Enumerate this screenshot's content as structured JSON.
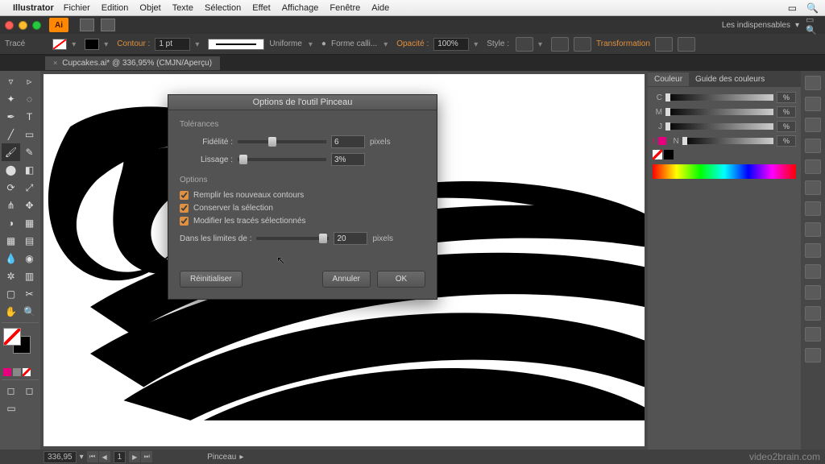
{
  "menubar": {
    "app": "Illustrator",
    "items": [
      "Fichier",
      "Edition",
      "Objet",
      "Texte",
      "Sélection",
      "Effet",
      "Affichage",
      "Fenêtre",
      "Aide"
    ]
  },
  "titlebar": {
    "ai_badge": "Ai",
    "workspace": "Les indispensables"
  },
  "controlbar": {
    "left_label": "Tracé",
    "stroke_label": "Contour :",
    "stroke_val": "1 pt",
    "uniform": "Uniforme",
    "brush_style": "Forme calli...",
    "opacity_label": "Opacité :",
    "opacity_val": "100%",
    "style_label": "Style :",
    "transform": "Transformation"
  },
  "doc_tab": {
    "title": "Cupcakes.ai* @ 336,95% (CMJN/Aperçu)"
  },
  "dialog": {
    "title": "Options de l'outil Pinceau",
    "tolerances_label": "Tolérances",
    "fidelity_label": "Fidélité :",
    "fidelity_val": "6",
    "fidelity_unit": "pixels",
    "smoothing_label": "Lissage :",
    "smoothing_val": "3%",
    "options_label": "Options",
    "fill_new": "Remplir les nouveaux contours",
    "keep_sel": "Conserver la sélection",
    "edit_sel": "Modifier les tracés sélectionnés",
    "within_label": "Dans les limites de :",
    "within_val": "20",
    "within_unit": "pixels",
    "reset": "Réinitialiser",
    "cancel": "Annuler",
    "ok": "OK"
  },
  "color_panel": {
    "tab1": "Couleur",
    "tab2": "Guide des couleurs",
    "channels": [
      "C",
      "M",
      "J",
      "N"
    ],
    "pct": "%"
  },
  "statusbar": {
    "zoom": "336,95",
    "page": "1",
    "tool": "Pinceau"
  },
  "watermark": "video2brain.com"
}
